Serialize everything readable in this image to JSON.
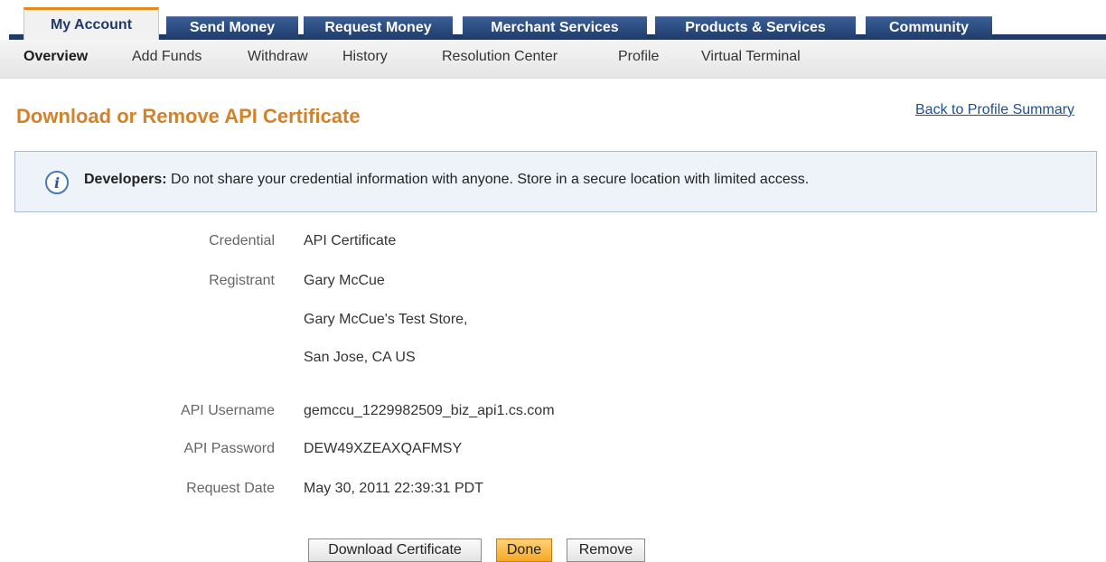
{
  "tabs": [
    "My Account",
    "Send Money",
    "Request Money",
    "Merchant Services",
    "Products & Services",
    "Community"
  ],
  "subnav": [
    "Overview",
    "Add Funds",
    "Withdraw",
    "History",
    "Resolution Center",
    "Profile",
    "Virtual Terminal"
  ],
  "page_title": "Download or Remove API Certificate",
  "back_link": "Back to Profile Summary",
  "notice": {
    "bold": "Developers:",
    "text": " Do not share your credential information with anyone. Store in a secure location with limited access."
  },
  "details": {
    "credential_label": "Credential",
    "credential_value": "API Certificate",
    "registrant_label": "Registrant",
    "registrant_name": "Gary McCue",
    "registrant_store": "Gary McCue's Test Store,",
    "registrant_location": "San Jose, CA US",
    "username_label": "API Username",
    "username_value": "gemccu_1229982509_biz_api1.cs.com",
    "password_label": "API Password",
    "password_value": "DEW49XZEAXQAFMSY",
    "date_label": "Request Date",
    "date_value": "May 30, 2011 22:39:31 PDT"
  },
  "buttons": {
    "download": "Download Certificate",
    "done": "Done",
    "remove": "Remove"
  }
}
